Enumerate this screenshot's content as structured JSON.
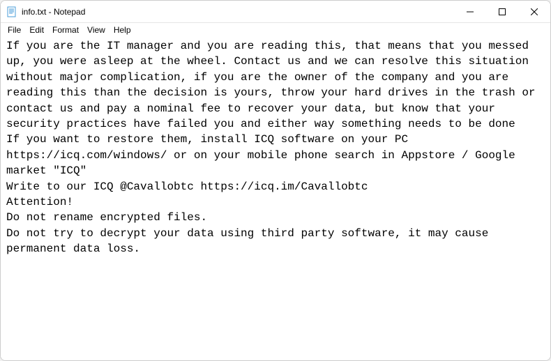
{
  "window": {
    "title": "info.txt - Notepad"
  },
  "menu": {
    "file": "File",
    "edit": "Edit",
    "format": "Format",
    "view": "View",
    "help": "Help"
  },
  "content": {
    "text": "If you are the IT manager and you are reading this, that means that you messed up, you were asleep at the wheel. Contact us and we can resolve this situation without major complication, if you are the owner of the company and you are reading this than the decision is yours, throw your hard drives in the trash or contact us and pay a nominal fee to recover your data, but know that your security practices have failed you and either way something needs to be done\nIf you want to restore them, install ICQ software on your PC https://icq.com/windows/ or on your mobile phone search in Appstore / Google market \"ICQ\"\nWrite to our ICQ @Cavallobtc https://icq.im/Cavallobtc\nAttention!\nDo not rename encrypted files.\nDo not try to decrypt your data using third party software, it may cause permanent data loss."
  }
}
